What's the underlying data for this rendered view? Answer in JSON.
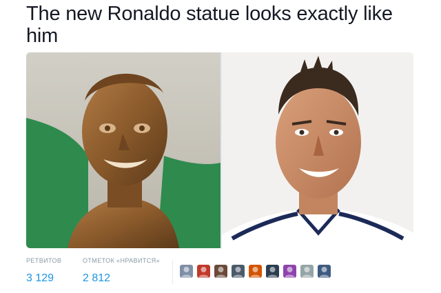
{
  "tweet": {
    "text": "The new Ronaldo statue looks exactly like him"
  },
  "stats": {
    "retweets_label": "РЕТВИТОВ",
    "retweets_count": "3 129",
    "likes_label": "ОТМЕТОК «НРАВИТСЯ»",
    "likes_count": "2 812"
  },
  "colors": {
    "text": "#141823",
    "accent": "#1b95e0",
    "muted": "#8899a6",
    "bronze": "#8a5a2b",
    "flag_green": "#2f8a4e"
  },
  "avatars": [
    {
      "color": "#7f8fa6"
    },
    {
      "color": "#c0392b"
    },
    {
      "color": "#6b4a3a"
    },
    {
      "color": "#4a5a6a"
    },
    {
      "color": "#d35400"
    },
    {
      "color": "#2c3e50"
    },
    {
      "color": "#8e44ad"
    },
    {
      "color": "#95a5a6"
    },
    {
      "color": "#3d5a80"
    }
  ]
}
